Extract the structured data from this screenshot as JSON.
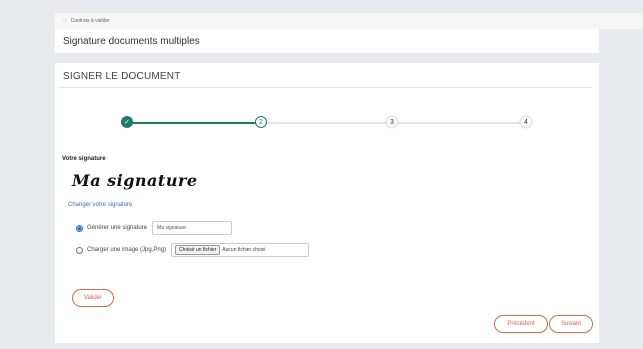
{
  "breadcrumb": {
    "icon": "home-icon",
    "label": "Contrats à valider"
  },
  "page": {
    "title": "Signature documents multiples"
  },
  "section": {
    "title": "SIGNER LE DOCUMENT"
  },
  "stepper": {
    "current_step": 2,
    "steps": [
      {
        "label": "✓",
        "state": "done"
      },
      {
        "label": "2",
        "state": "active"
      },
      {
        "label": "3",
        "state": "todo"
      },
      {
        "label": "4",
        "state": "todo"
      }
    ],
    "colors": {
      "done": "#1f7b66",
      "todo": "#e4e4e4"
    }
  },
  "signature": {
    "label": "Votre signature",
    "preview": "Ma signature",
    "change_link": "Changer votre signature"
  },
  "options": {
    "generate": {
      "label": "Générer une signature",
      "selected": true,
      "input_value": "Ma signature"
    },
    "upload": {
      "label": "Charger une image (Jpg,Png)",
      "selected": false,
      "button": "Choisir un fichier",
      "status": "Aucun fichier choisi"
    }
  },
  "buttons": {
    "validate": "Valider",
    "previous": "Précédent",
    "next": "Suivant"
  },
  "colors": {
    "accent": "#d9684a",
    "link": "#3a6fc4",
    "brand": "#1f7b66"
  }
}
